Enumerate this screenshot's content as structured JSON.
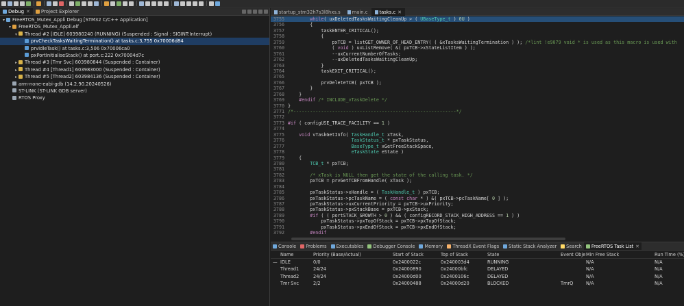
{
  "left_tabs": [
    {
      "label": "Debug",
      "active": true
    },
    {
      "label": "Project Explorer",
      "active": false
    }
  ],
  "tree": [
    {
      "indent": 0,
      "arrow": "v",
      "icon": "project-icon",
      "color": "#6fa8dc",
      "text": "FreeRTOS_Mutex_Appli Debug [STM32 C/C++ Application]"
    },
    {
      "indent": 1,
      "arrow": "v",
      "icon": "elf-icon",
      "color": "#e0a040",
      "text": "FreeRTOS_Mutex_Appli.elf"
    },
    {
      "indent": 2,
      "arrow": "v",
      "icon": "thread-icon",
      "color": "#d9b34a",
      "text": "Thread #2 [IDLE] 603980240 (RUNNING) (Suspended : Signal : SIGINT:Interrupt)"
    },
    {
      "indent": 3,
      "arrow": "",
      "icon": "stack-frame-icon",
      "color": "#5b9bd5",
      "text": "prvCheckTasksWaitingTermination() at tasks.c:3,755 0x70006d84",
      "selected": true
    },
    {
      "indent": 3,
      "arrow": "",
      "icon": "stack-frame-icon",
      "color": "#5b9bd5",
      "text": "prvIdleTask() at tasks.c:3,506 0x70006ca0"
    },
    {
      "indent": 3,
      "arrow": "",
      "icon": "stack-frame-icon",
      "color": "#5b9bd5",
      "text": "pxPortInitialiseStack() at port.c:222 0x70004d7c"
    },
    {
      "indent": 2,
      "arrow": ">",
      "icon": "thread-icon",
      "color": "#d9b34a",
      "text": "Thread #3 [Tmr Svc] 603980844 (Suspended : Container)"
    },
    {
      "indent": 2,
      "arrow": ">",
      "icon": "thread-icon",
      "color": "#d9b34a",
      "text": "Thread #4 [Thread1] 603983000 (Suspended : Container)"
    },
    {
      "indent": 2,
      "arrow": ">",
      "icon": "thread-icon",
      "color": "#d9b34a",
      "text": "Thread #5 [Thread2] 603984136 (Suspended : Container)"
    },
    {
      "indent": 1,
      "arrow": "",
      "icon": "gdb-icon",
      "color": "#9aa6b2",
      "text": "arm-none-eabi-gdb (14.2.90.20240526)"
    },
    {
      "indent": 1,
      "arrow": "",
      "icon": "stlink-icon",
      "color": "#9aa6b2",
      "text": "ST-LINK (ST-LINK GDB server)"
    },
    {
      "indent": 1,
      "arrow": "",
      "icon": "rtos-icon",
      "color": "#9aa6b2",
      "text": "RTOS Proxy"
    }
  ],
  "editor_tabs": [
    {
      "label": "startup_stm32h7s3l8hxs.s",
      "active": false
    },
    {
      "label": "main.c",
      "active": false
    },
    {
      "label": "tasks.c",
      "active": true
    }
  ],
  "code_lines": [
    {
      "num": "3755",
      "hl": true,
      "html": "        <span class='kw'>while</span>( uxDeletedTasksWaitingCleanUp &gt; ( <span class='ty'>UBaseType_t</span> ) <span class='nm'>0U</span> )"
    },
    {
      "num": "3756",
      "html": "        {"
    },
    {
      "num": "3757",
      "html": "            taskENTER_CRITICAL();"
    },
    {
      "num": "3758",
      "html": "            {"
    },
    {
      "num": "3759",
      "html": "                pxTCB = listGET_OWNER_OF_HEAD_ENTRY( ( &amp;xTasksWaitingTermination ) ); <span class='cm'>/*lint !e9079 void * is used as this macro is used with</span>"
    },
    {
      "num": "3760",
      "html": "                ( <span class='kw'>void</span> ) uxListRemove( &amp;( pxTCB-&gt;xStateListItem ) );"
    },
    {
      "num": "3761",
      "html": "                --uxCurrentNumberOfTasks;"
    },
    {
      "num": "3762",
      "html": "                --uxDeletedTasksWaitingCleanUp;"
    },
    {
      "num": "3763",
      "html": "            }"
    },
    {
      "num": "3764",
      "html": "            taskEXIT_CRITICAL();"
    },
    {
      "num": "3765",
      "html": ""
    },
    {
      "num": "3766",
      "html": "            prvDeleteTCB( pxTCB );"
    },
    {
      "num": "3767",
      "html": "        }"
    },
    {
      "num": "3768",
      "html": "    }"
    },
    {
      "num": "3769",
      "html": "    <span class='pp'>#endif</span> <span class='cm'>/* INCLUDE_vTaskDelete */</span>"
    },
    {
      "num": "3770",
      "html": "}"
    },
    {
      "num": "3771",
      "html": "<span class='cm'>/*-----------------------------------------------------------*/</span>"
    },
    {
      "num": "3772",
      "html": ""
    },
    {
      "num": "3773",
      "html": "<span class='pp'>#if</span> ( configUSE_TRACE_FACILITY == <span class='nm'>1</span> )"
    },
    {
      "num": "3774",
      "html": ""
    },
    {
      "num": "3775",
      "html": "    <span class='kw'>void</span> vTaskGetInfo( <span class='ty'>TaskHandle_t</span> xTask,"
    },
    {
      "num": "3776",
      "html": "                       <span class='ty'>TaskStatus_t</span> * pxTaskStatus,"
    },
    {
      "num": "3777",
      "html": "                       <span class='ty'>BaseType_t</span> xGetFreeStackSpace,"
    },
    {
      "num": "3778",
      "html": "                       <span class='ty'>eTaskState</span> eState )"
    },
    {
      "num": "3779",
      "html": "    {"
    },
    {
      "num": "3780",
      "html": "        <span class='ty'>TCB_t</span> * pxTCB;"
    },
    {
      "num": "3781",
      "html": ""
    },
    {
      "num": "3782",
      "html": "        <span class='cm'>/* xTask is NULL then get the state of the calling task. */</span>"
    },
    {
      "num": "3783",
      "html": "        pxTCB = prvGetTCBFromHandle( xTask );"
    },
    {
      "num": "3784",
      "html": ""
    },
    {
      "num": "3785",
      "html": "        pxTaskStatus-&gt;xHandle = ( <span class='ty'>TaskHandle_t</span> ) pxTCB;"
    },
    {
      "num": "3786",
      "html": "        pxTaskStatus-&gt;pcTaskName = ( <span class='kw'>const</span> <span class='kw'>char</span> * ) &amp;( pxTCB-&gt;pcTaskName[ <span class='nm'>0</span> ] );"
    },
    {
      "num": "3787",
      "html": "        pxTaskStatus-&gt;uxCurrentPriority = pxTCB-&gt;uxPriority;"
    },
    {
      "num": "3788",
      "html": "        pxTaskStatus-&gt;pxStackBase = pxTCB-&gt;pxStack;"
    },
    {
      "num": "3789",
      "html": "        <span class='pp'>#if</span> ( ( portSTACK_GROWTH &gt; <span class='nm'>0</span> ) &amp;&amp; ( configRECORD_STACK_HIGH_ADDRESS == <span class='nm'>1</span> ) )"
    },
    {
      "num": "3790",
      "html": "            pxTaskStatus-&gt;pxTopOfStack = pxTCB-&gt;pxTopOfStack;"
    },
    {
      "num": "3791",
      "html": "            pxTaskStatus-&gt;pxEndOfStack = pxTCB-&gt;pxEndOfStack;"
    },
    {
      "num": "3792",
      "html": "        <span class='pp'>#endif</span>"
    }
  ],
  "bottom_tabs": [
    {
      "label": "Console",
      "icon": "console-icon",
      "color": "#6fa8dc",
      "active": false
    },
    {
      "label": "Problems",
      "icon": "problems-icon",
      "color": "#e06666",
      "active": false
    },
    {
      "label": "Executables",
      "icon": "executables-icon",
      "color": "#6fa8dc",
      "active": false
    },
    {
      "label": "Debugger Console",
      "icon": "debugger-console-icon",
      "color": "#93c47d",
      "active": false
    },
    {
      "label": "Memory",
      "icon": "memory-icon",
      "color": "#6fa8dc",
      "active": false
    },
    {
      "label": "ThreadX Event Flags",
      "icon": "threadx-icon",
      "color": "#f6b26b",
      "active": false
    },
    {
      "label": "Static Stack Analyzer",
      "icon": "stack-analyzer-icon",
      "color": "#6fa8dc",
      "active": false
    },
    {
      "label": "Search",
      "icon": "search-icon",
      "color": "#ffd966",
      "active": false
    },
    {
      "label": "FreeRTOS Task List",
      "icon": "freertos-icon",
      "color": "#93c47d",
      "active": true
    }
  ],
  "task_table": {
    "columns": [
      "Name",
      "Priority (Base/Actual)",
      "Start of Stack",
      "Top of Stack",
      "State",
      "Event Obje",
      "Min Free Stack",
      "Run Time (%)"
    ],
    "rows": [
      {
        "marker": "—",
        "cells": [
          "IDLE",
          "0/0",
          "0x2400022c",
          "0x240003d4",
          "RUNNING",
          "",
          "N/A",
          "N/A"
        ]
      },
      {
        "marker": "",
        "cells": [
          "Thread1",
          "24/24",
          "0x24000890",
          "0x24000bfc",
          "DELAYED",
          "",
          "N/A",
          "N/A"
        ]
      },
      {
        "marker": "",
        "cells": [
          "Thread2",
          "24/24",
          "0x24000d00",
          "0x2400106c",
          "DELAYED",
          "",
          "N/A",
          "N/A"
        ]
      },
      {
        "marker": "",
        "cells": [
          "Tmr Svc",
          "2/2",
          "0x24000488",
          "0x24000d20",
          "BLOCKED",
          "TmrQ",
          "N/A",
          "N/A"
        ]
      }
    ]
  }
}
